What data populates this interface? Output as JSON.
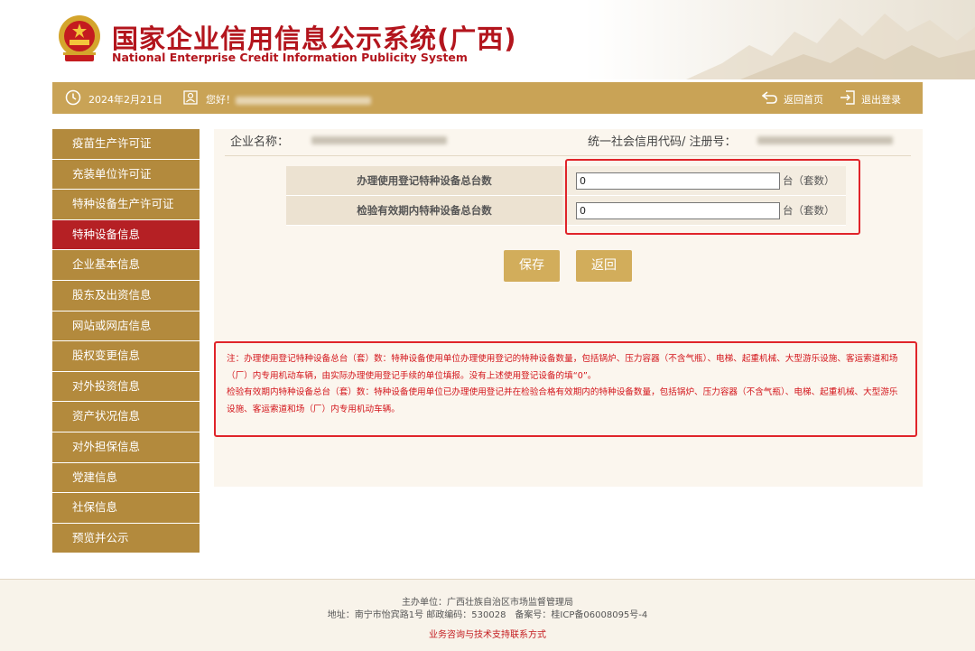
{
  "header": {
    "title_cn": "国家企业信用信息公示系统(广西)",
    "title_en": "National Enterprise Credit Information Publicity System"
  },
  "infobar": {
    "date": "2024年2月21日",
    "greeting_prefix": "您好！",
    "home_label": "返回首页",
    "logout_label": "退出登录"
  },
  "sidebar": {
    "items": [
      {
        "label": "疫苗生产许可证"
      },
      {
        "label": "充装单位许可证"
      },
      {
        "label": "特种设备生产许可证"
      },
      {
        "label": "特种设备信息",
        "active": true
      },
      {
        "label": "企业基本信息"
      },
      {
        "label": "股东及出资信息"
      },
      {
        "label": "网站或网店信息"
      },
      {
        "label": "股权变更信息"
      },
      {
        "label": "对外投资信息"
      },
      {
        "label": "资产状况信息"
      },
      {
        "label": "对外担保信息"
      },
      {
        "label": "党建信息"
      },
      {
        "label": "社保信息"
      },
      {
        "label": "预览并公示"
      }
    ]
  },
  "main": {
    "company_label": "企业名称：",
    "code_label": "统一社会信用代码/ 注册号：",
    "form": {
      "rows": [
        {
          "label": "办理使用登记特种设备总台数",
          "value": "0",
          "unit": "台（套数）"
        },
        {
          "label": "检验有效期内特种设备总台数",
          "value": "0",
          "unit": "台（套数）"
        }
      ]
    },
    "buttons": {
      "save": "保存",
      "back": "返回"
    },
    "note": {
      "p1": "注：办理使用登记特种设备总台（套）数：特种设备使用单位办理使用登记的特种设备数量，包括锅炉、压力容器（不含气瓶）、电梯、起重机械、大型游乐设施、客运索道和场（厂）内专用机动车辆，由实际办理使用登记手续的单位填报。没有上述使用登记设备的填“0”。",
      "p2": "检验有效期内特种设备总台（套）数：特种设备使用单位已办理使用登记并在检验合格有效期内的特种设备数量，包括锅炉、压力容器（不含气瓶）、电梯、起重机械、大型游乐设施、客运索道和场（厂）内专用机动车辆。"
    }
  },
  "footer": {
    "line1": "主办单位：广西壮族自治区市场监督管理局",
    "line2": "地址：南宁市怡宾路1号 邮政编码：530028　备案号：桂ICP备06008095号-4",
    "line3": "业务咨询与技术支持联系方式"
  },
  "colors": {
    "brand_red": "#b3151d",
    "gold": "#c9a356",
    "sidebar": "#b38a3d",
    "sidebar_active": "#b52024",
    "highlight": "#e0242a"
  }
}
